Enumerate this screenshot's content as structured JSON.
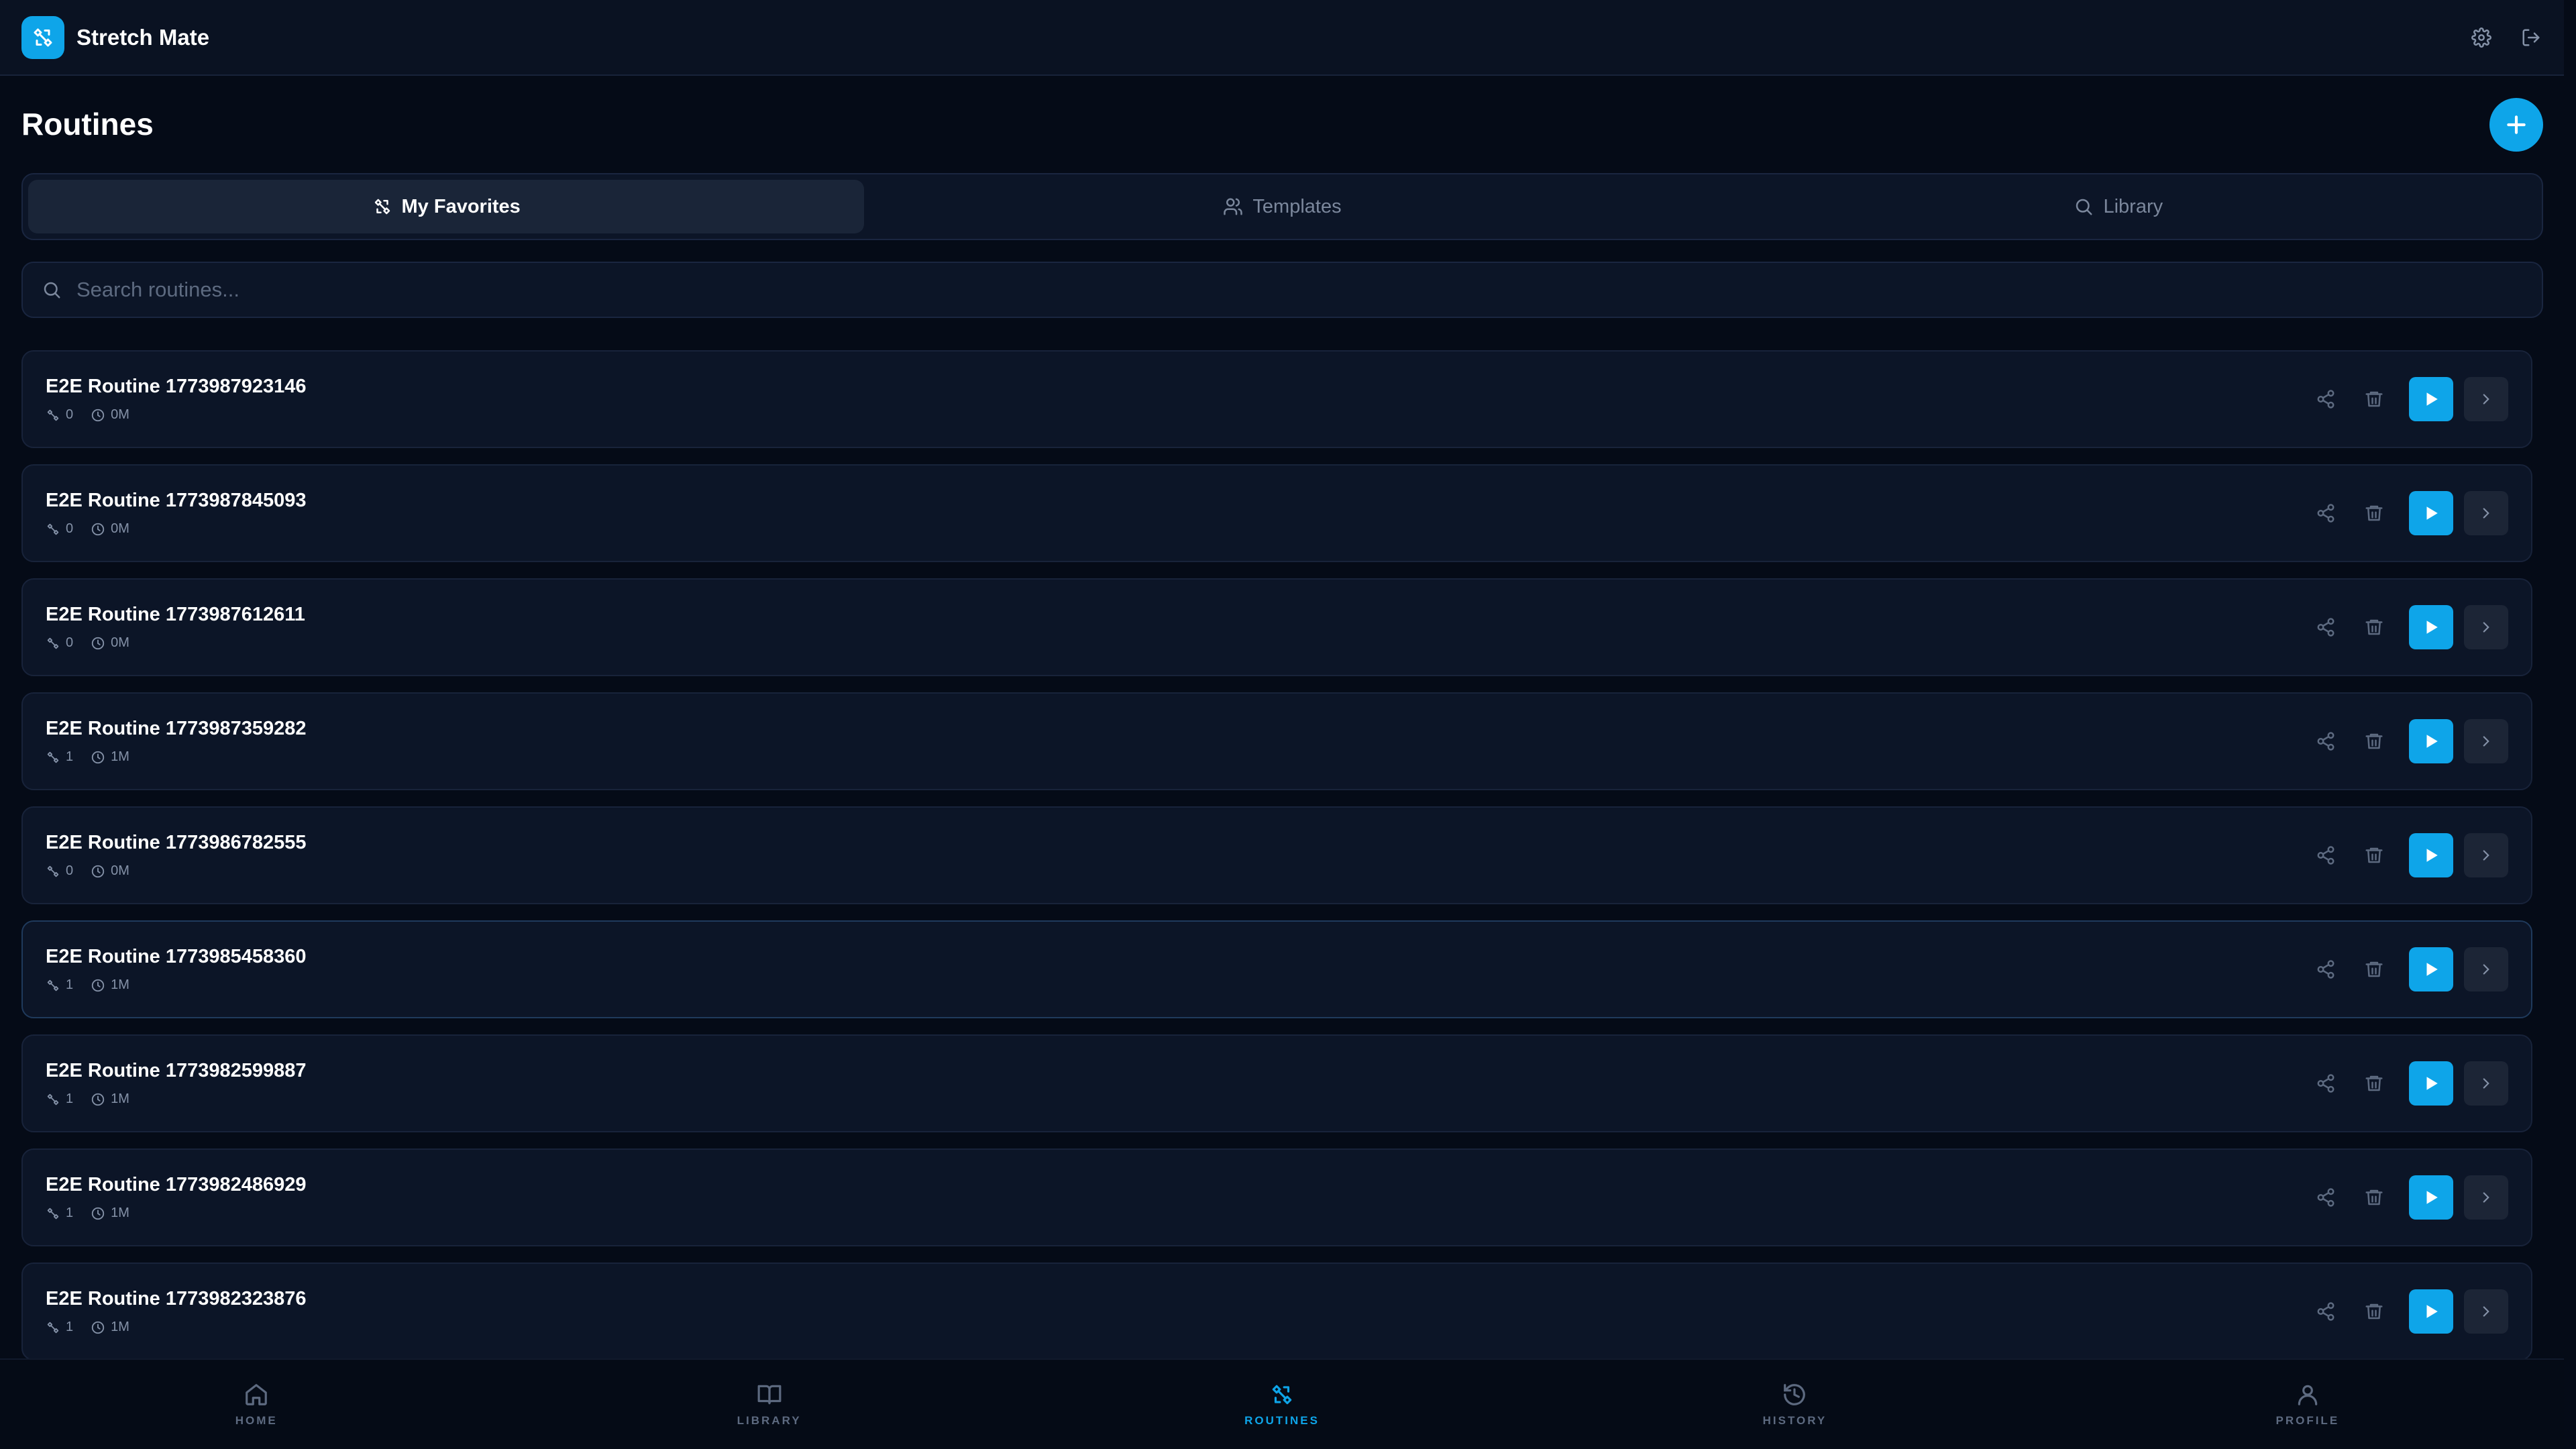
{
  "app": {
    "title": "Stretch Mate",
    "logo_icon": "stretch-logo-icon"
  },
  "header_actions": [
    {
      "name": "settings",
      "icon": "gear-icon"
    },
    {
      "name": "logout",
      "icon": "logout-icon"
    }
  ],
  "page": {
    "title": "Routines",
    "add_button_icon": "plus-icon"
  },
  "tabs": [
    {
      "label": "My Favorites",
      "icon": "stretch-icon",
      "active": true
    },
    {
      "label": "Templates",
      "icon": "users-icon",
      "active": false
    },
    {
      "label": "Library",
      "icon": "search-icon",
      "active": false
    }
  ],
  "search": {
    "placeholder": "Search routines...",
    "value": ""
  },
  "routines": [
    {
      "name": "E2E Routine 1773987923146",
      "count": "0",
      "duration": "0M"
    },
    {
      "name": "E2E Routine 1773987845093",
      "count": "0",
      "duration": "0M"
    },
    {
      "name": "E2E Routine 1773987612611",
      "count": "0",
      "duration": "0M"
    },
    {
      "name": "E2E Routine 1773987359282",
      "count": "1",
      "duration": "1M"
    },
    {
      "name": "E2E Routine 1773986782555",
      "count": "0",
      "duration": "0M"
    },
    {
      "name": "E2E Routine 1773985458360",
      "count": "1",
      "duration": "1M"
    },
    {
      "name": "E2E Routine 1773982599887",
      "count": "1",
      "duration": "1M"
    },
    {
      "name": "E2E Routine 1773982486929",
      "count": "1",
      "duration": "1M"
    },
    {
      "name": "E2E Routine 1773982323876",
      "count": "1",
      "duration": "1M"
    }
  ],
  "bottom_nav": [
    {
      "label": "HOME",
      "icon": "home-icon",
      "active": false
    },
    {
      "label": "LIBRARY",
      "icon": "book-icon",
      "active": false
    },
    {
      "label": "ROUTINES",
      "icon": "stretch-icon",
      "active": true
    },
    {
      "label": "HISTORY",
      "icon": "history-icon",
      "active": false
    },
    {
      "label": "PROFILE",
      "icon": "user-icon",
      "active": false
    }
  ],
  "colors": {
    "accent": "#0ea5e9",
    "background": "#050b17",
    "card": "#0c1527"
  }
}
